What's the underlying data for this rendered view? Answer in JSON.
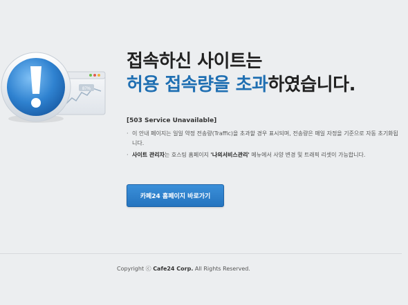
{
  "title": {
    "line1": "접속하신 사이트는",
    "line2_highlight": "허용 접속량을 초과",
    "line2_rest": "하였습니다."
  },
  "status": "[503 Service Unavailable]",
  "notes": [
    {
      "bullet": "·",
      "text": "이 안내 페이지는 일일 약정 전송량(Traffic)을 초과할 경우 표시되며, 전송량은 매일 자정을 기준으로 자동 초기화됩니다."
    },
    {
      "bullet": "·",
      "bold1": "사이트 관리자",
      "text1": "는 호스팅 홈페이지 ",
      "bold2": "'나의서비스관리'",
      "text2": " 메뉴에서 사양 변경 및 트래픽 리셋이 가능합니다."
    }
  ],
  "home_button": "카페24 홈페이지 바로가기",
  "footer": {
    "prefix": "Copyright ⓒ ",
    "company": "Cafe24 Corp.",
    "suffix": " All Rights Reserved."
  },
  "illustration": {
    "icon": "exclamation-icon",
    "window_badge": "87%",
    "colors": {
      "accent": "#1f6fb2",
      "button": "#2e82cc"
    }
  }
}
